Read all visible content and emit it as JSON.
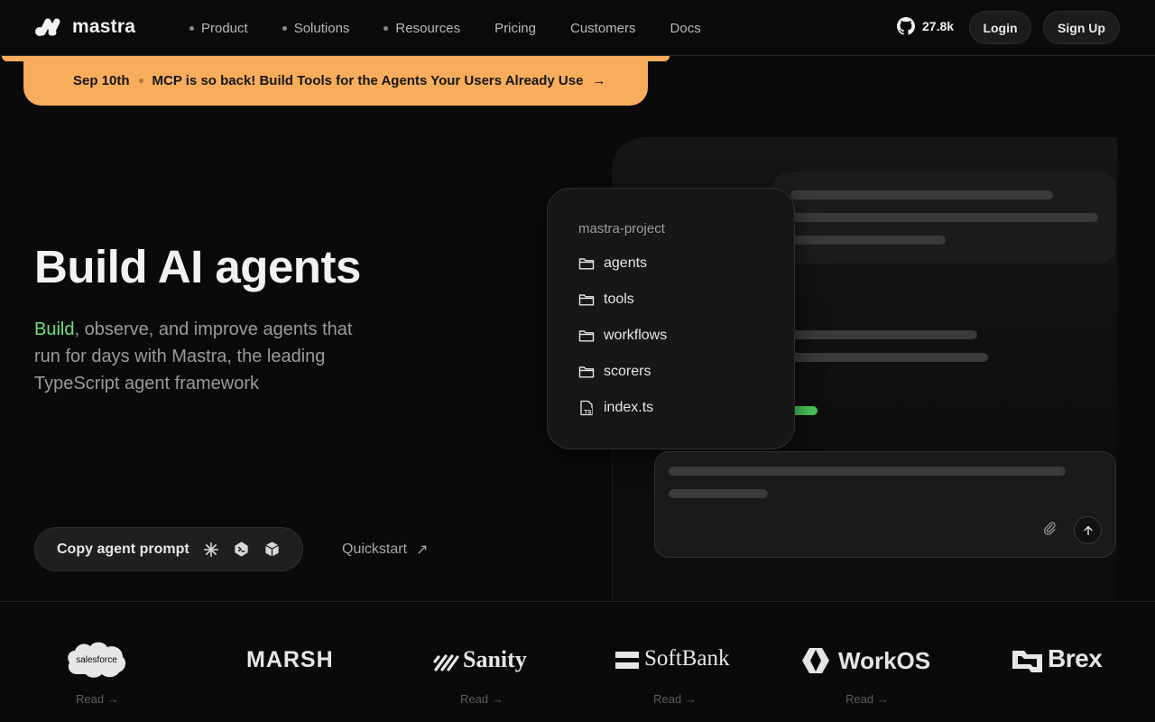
{
  "nav": {
    "brand": "mastra",
    "links": [
      {
        "label": "Product",
        "dot": true
      },
      {
        "label": "Solutions",
        "dot": true
      },
      {
        "label": "Resources",
        "dot": true
      },
      {
        "label": "Pricing",
        "dot": false
      },
      {
        "label": "Customers",
        "dot": false
      },
      {
        "label": "Docs",
        "dot": false
      }
    ],
    "github_stars": "27.8k",
    "login": "Login",
    "signup": "Sign Up"
  },
  "banner": {
    "date": "Sep 10th",
    "message": "MCP is so back! Build Tools for the Agents Your Users Already Use",
    "arrow": "→"
  },
  "hero": {
    "title": "Build AI agents",
    "subtitle_highlight": "Build",
    "subtitle_rest": ", observe, and improve agents that run for days with Mastra, the leading TypeScript agent framework",
    "copy_button": "Copy agent prompt",
    "quickstart": "Quickstart",
    "quickstart_arrow": "↗"
  },
  "project": {
    "title": "mastra-project",
    "items": [
      "agents",
      "tools",
      "workflows",
      "scorers",
      "index.ts"
    ]
  },
  "logos": {
    "read_label": "Read →",
    "companies": [
      "salesforce",
      "MARSH",
      "Sanity",
      "SoftBank",
      "WorkOS",
      "Brex"
    ]
  },
  "colors": {
    "accent_green": "#6ee27a",
    "banner_orange": "#f8ad5c",
    "background": "#0a0a0a"
  }
}
